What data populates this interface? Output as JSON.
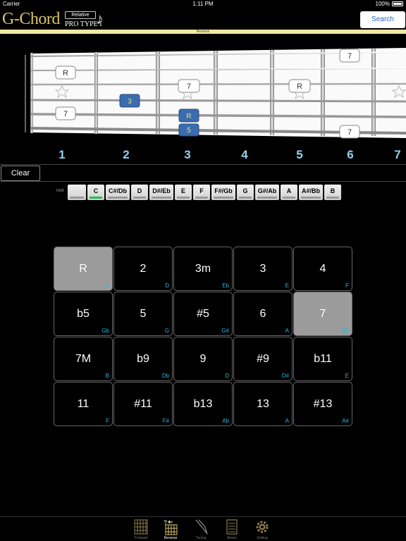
{
  "status_bar": {
    "carrier": "Carrier",
    "time": "1:11 PM",
    "battery": "100%"
  },
  "header": {
    "logo": "G-Chord",
    "logo_relative": "Relative",
    "logo_sub": "PRO TYPE I",
    "search_label": "Search"
  },
  "mode_strip": "Reverse",
  "fretboard": {
    "fret_numbers": [
      "1",
      "2",
      "3",
      "4",
      "5",
      "6",
      "7"
    ],
    "markers": [
      {
        "label": "R",
        "style": "white"
      },
      {
        "label": "7",
        "style": "white"
      },
      {
        "label": "3",
        "style": "blue"
      },
      {
        "label": "7",
        "style": "white"
      },
      {
        "label": "R",
        "style": "blue"
      },
      {
        "label": "5",
        "style": "blue"
      },
      {
        "label": "R",
        "style": "white"
      },
      {
        "label": "7",
        "style": "white"
      },
      {
        "label": "7",
        "style": "white"
      }
    ]
  },
  "clear_label": "Clear",
  "root": {
    "label": "root",
    "keys": [
      "",
      "C",
      "C#/Db",
      "D",
      "D#/Eb",
      "E",
      "F",
      "F#/Gb",
      "G",
      "G#/Ab",
      "A",
      "A#/Bb",
      "B"
    ],
    "selected": "C"
  },
  "intervals": [
    {
      "label": "R",
      "note": "C",
      "on": true
    },
    {
      "label": "2",
      "note": "D",
      "on": false
    },
    {
      "label": "3m",
      "note": "Eb",
      "on": false
    },
    {
      "label": "3",
      "note": "E",
      "on": false
    },
    {
      "label": "4",
      "note": "F",
      "on": false
    },
    {
      "label": "b5",
      "note": "Gb",
      "on": false
    },
    {
      "label": "5",
      "note": "G",
      "on": false
    },
    {
      "label": "#5",
      "note": "G#",
      "on": false
    },
    {
      "label": "6",
      "note": "A",
      "on": false
    },
    {
      "label": "7",
      "note": "Bb",
      "on": true
    },
    {
      "label": "7M",
      "note": "B",
      "on": false
    },
    {
      "label": "b9",
      "note": "Db",
      "on": false
    },
    {
      "label": "9",
      "note": "D",
      "on": false
    },
    {
      "label": "#9",
      "note": "D#",
      "on": false
    },
    {
      "label": "b11",
      "note": "E",
      "on": false
    },
    {
      "label": "11",
      "note": "F",
      "on": false
    },
    {
      "label": "#11",
      "note": "F#",
      "on": false
    },
    {
      "label": "b13",
      "note": "Ab",
      "on": false
    },
    {
      "label": "13",
      "note": "A",
      "on": false
    },
    {
      "label": "#13",
      "note": "A#",
      "on": false
    }
  ],
  "tabs": [
    {
      "label": "Forward",
      "icon": "chord-grid-icon"
    },
    {
      "label": "Reverse",
      "icon": "reverse-chord-icon",
      "active": true
    },
    {
      "label": "Tuning",
      "icon": "tuning-fork-icon"
    },
    {
      "label": "Memo",
      "icon": "notepad-icon"
    },
    {
      "label": "Setting",
      "icon": "gear-icon"
    }
  ]
}
